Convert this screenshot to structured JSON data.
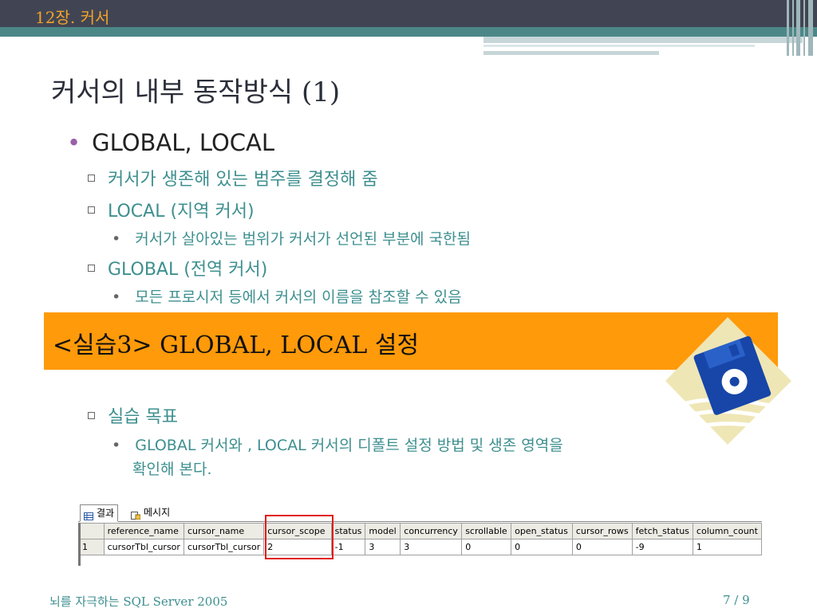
{
  "header": {
    "chapter": "12장. 커서"
  },
  "slide": {
    "title": "커서의 내부 동작방식 (1)"
  },
  "bullets": {
    "main": "GLOBAL, LOCAL",
    "scope_desc": "커서가 생존해 있는 범주를 결정해 줌",
    "local_title": "LOCAL (지역 커서)",
    "local_desc": "커서가 살아있는 범위가 커서가 선언된 부분에 국한됨",
    "global_title": "GLOBAL (전역 커서)",
    "global_desc": "모든 프로시저 등에서 커서의 이름을 참조할 수 있음"
  },
  "banner": {
    "text": "<실습3>  GLOBAL, LOCAL 설정"
  },
  "practice": {
    "goal_title": "실습 목표",
    "goal_desc_line1": "GLOBAL 커서와 , LOCAL 커서의 디폴트 설정 방법 및 생존 영역을",
    "goal_desc_line2": "확인해 본다."
  },
  "results": {
    "tabs": [
      "결과",
      "메시지"
    ],
    "columns": [
      "reference_name",
      "cursor_name",
      "cursor_scope",
      "status",
      "model",
      "concurrency",
      "scrollable",
      "open_status",
      "cursor_rows",
      "fetch_status",
      "column_count"
    ],
    "rows": [
      {
        "row_num": "1",
        "cells": [
          "cursorTbl_cursor",
          "cursorTbl_cursor",
          "2",
          "-1",
          "3",
          "3",
          "0",
          "0",
          "0",
          "-9",
          "1"
        ]
      }
    ]
  },
  "footer": {
    "left": "뇌를 자극하는 SQL Server 2005",
    "page": "7 / 9"
  },
  "colors": {
    "header_dark": "#414553",
    "header_teal": "#4c8788",
    "accent_orange": "#ff9a0a",
    "text_teal": "#3e8f8f",
    "bullet_purple": "#9b5fa9",
    "highlight_red": "#e21b1b"
  }
}
